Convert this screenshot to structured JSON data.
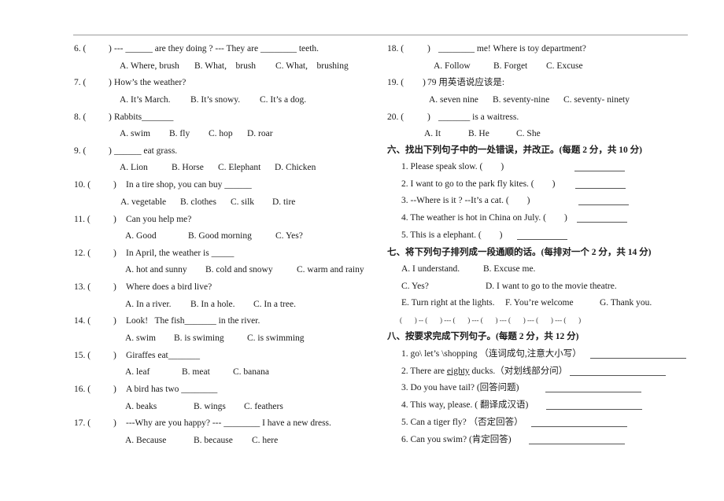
{
  "left_column": [
    {
      "num": "6. (",
      "close": ")",
      "stem": "--- ______ are they doing ? --- They are ________ teeth.",
      "options": [
        "A. Where, brush",
        "B. What,    brush",
        "C. What,    brushing"
      ]
    },
    {
      "num": "7. (",
      "close": ")",
      "stem": "How’s the weather?",
      "options": [
        "A. It’s March.",
        "B. It’s snowy.",
        "C. It’s a dog."
      ]
    },
    {
      "num": "8. (",
      "close": ")",
      "stem": "Rabbits_______",
      "options": [
        "A. swim",
        "B. fly",
        "C. hop",
        "D. roar"
      ]
    },
    {
      "num": "9. (",
      "close": ")",
      "stem": "______ eat grass.",
      "options": [
        "A. Lion",
        "B. Horse",
        "C. Elephant",
        "D. Chicken"
      ]
    },
    {
      "num": "10. (",
      "close": ")",
      "stem": "In a tire shop, you can buy ______",
      "options": [
        "A. vegetable",
        "B. clothes",
        "C. silk",
        "D. tire"
      ]
    },
    {
      "num": "11. (",
      "close": ")",
      "stem": "Can you help me?",
      "options": [
        "A. Good",
        "B. Good morning",
        "C. Yes?"
      ]
    },
    {
      "num": "12. (",
      "close": ")",
      "stem": "In April, the weather is _____",
      "options": [
        "A. hot and sunny",
        "B. cold and snowy",
        "C. warm and rainy"
      ]
    },
    {
      "num": "13. (",
      "close": ")",
      "stem": "Where does a bird live?",
      "options": [
        "A. In a river.",
        "B. In a hole.",
        "C. In a tree."
      ]
    },
    {
      "num": "14. (",
      "close": ")",
      "stem": "Look!   The fish_______ in the river.",
      "options": [
        "A. swim",
        "B. is swiming",
        "C. is swimming"
      ]
    },
    {
      "num": "15. (",
      "close": ")",
      "stem": "Giraffes eat_______",
      "options": [
        "A. leaf",
        "B. meat",
        "C. banana"
      ]
    },
    {
      "num": "16. (",
      "close": ")",
      "stem": "A bird has two ________",
      "options": [
        "A. beaks",
        "B. wings",
        "C. feathers"
      ]
    },
    {
      "num": "17. (",
      "close": ")",
      "stem": "---Why are you happy? --- ________ I have a new dress.",
      "options": [
        "A. Because",
        "B. because",
        "C. here"
      ]
    }
  ],
  "right_column": {
    "questions": [
      {
        "num": "18. (",
        "close": ")",
        "stem": "________ me! Where is toy department?",
        "options": [
          "A. Follow",
          "B. Forget",
          "C. Excuse"
        ]
      },
      {
        "num": "19. (",
        "close": ")",
        "stem": "79 用英语说应该是:",
        "options": [
          "A. seven nine",
          "B. seventy-nine",
          "C. seventy- ninety"
        ]
      },
      {
        "num": "20. (",
        "close": ")",
        "stem": "_______ is a waitress.",
        "options": [
          "A. It",
          "B. He",
          "C. She"
        ]
      }
    ],
    "section6": {
      "title": "六、找出下列句子中的一处错误，并改正。(每题 2 分，共 10 分)",
      "items": [
        "1. Please speak slow. (        )",
        "2. I want to go to the park fly kites. (        )",
        "3. --Where is it ? --It’s a cat. (        )",
        "4. The weather is hot in China on July. (        )",
        "5. This is a elephant. (        )"
      ]
    },
    "section7": {
      "title": "七、将下列句子排列成一段通顺的话。(每排对一个 2 分，共 14 分)",
      "items": [
        [
          "A. I understand.",
          "B. Excuse me."
        ],
        [
          "C. Yes?",
          "D. I want to go to the movie theatre."
        ],
        [
          "E. Turn right at the lights.",
          "F. You’re welcome",
          "G. Thank you."
        ]
      ],
      "sequence": "(       ) -- (       ) --- (       ) --- (       ) --- (       ) --- (       ) --- (       )"
    },
    "section8": {
      "title": "八、按要求完成下列句子。(每题 2 分，共 12 分)",
      "items": [
        {
          "pre": "1. go\\ let’s \\shopping ",
          "underlined": "",
          "post": "",
          "note": "（连词成句,注意大小写）"
        },
        {
          "pre": "2. There are ",
          "underlined": "eighty",
          "post": " ducks.",
          "note": "（对划线部分问）"
        },
        {
          "pre": "3. Do you have tail? ",
          "underlined": "",
          "post": "",
          "note": "(回答问题)"
        },
        {
          "pre": "4. This way, please. ",
          "underlined": "",
          "post": "",
          "note": "( 翻译成汉语)"
        },
        {
          "pre": "5. Can a tiger fly? ",
          "underlined": "",
          "post": "",
          "note": "（否定回答）"
        },
        {
          "pre": "6. Can you swim? ",
          "underlined": "",
          "post": "",
          "note": "(肯定回答)"
        }
      ]
    }
  }
}
